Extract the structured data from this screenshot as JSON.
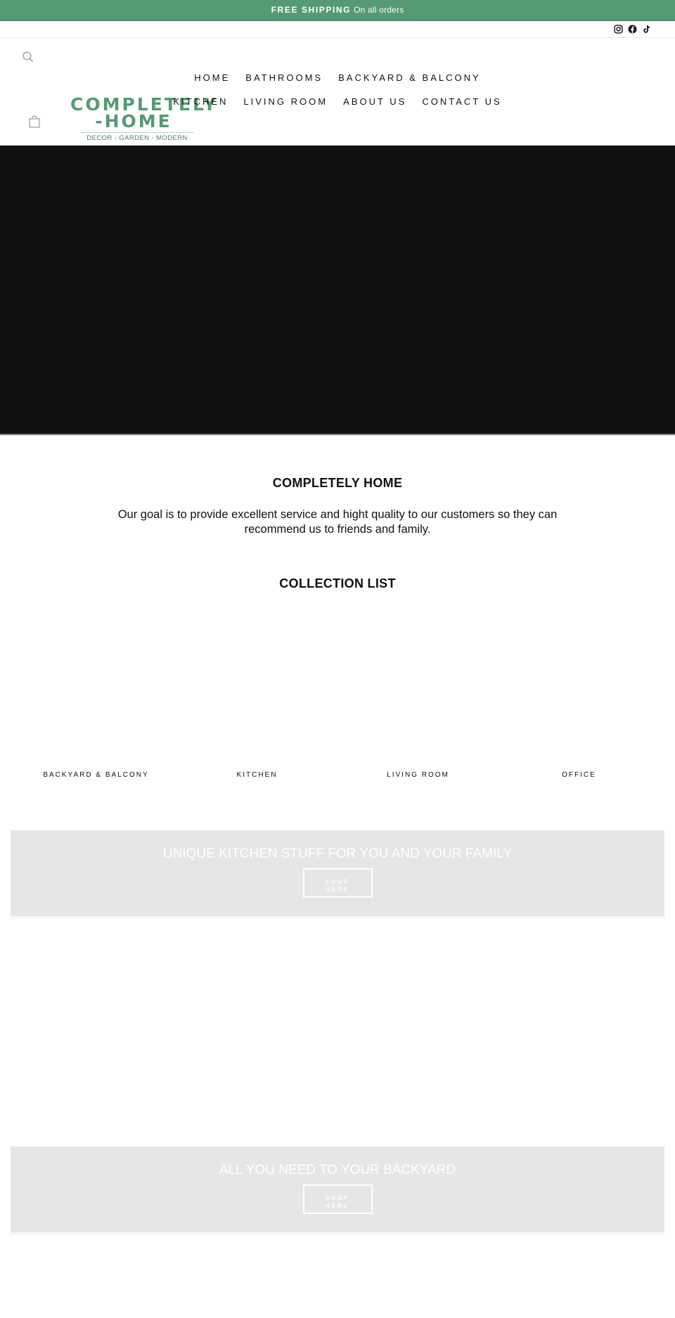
{
  "announcement": {
    "bold": "FREE SHIPPING",
    "text": "On all orders",
    "background": "#569a73"
  },
  "social": [
    {
      "name": "instagram",
      "icon": "instagram-icon"
    },
    {
      "name": "facebook",
      "icon": "facebook-icon"
    },
    {
      "name": "tiktok",
      "icon": "tiktok-icon"
    }
  ],
  "header": {
    "search_icon": "search-icon",
    "cart_icon": "cart-icon",
    "logo": {
      "line1": "COMPLETELY",
      "line2": "-HOME",
      "tagline": "DECOR - GARDEN - MODERN",
      "color": "#569a73"
    },
    "nav_row1": [
      "HOME",
      "BATHROOMS",
      "BACKYARD & BALCONY"
    ],
    "nav_row2": [
      "KITCHEN",
      "LIVING ROOM",
      "ABOUT US",
      "CONTACT US"
    ]
  },
  "hero": {
    "background": "#111111"
  },
  "intro": {
    "title": "COMPLETELY HOME",
    "text": "Our goal is to provide excellent service and hight quality to our customers so they can recommend us to friends and family."
  },
  "collections": {
    "title": "COLLECTION LIST",
    "items": [
      "BACKYARD & BALCONY",
      "KITCHEN",
      "LIVING ROOM",
      "OFFICE"
    ]
  },
  "promos": [
    {
      "title": "UNIQUE KITCHEN STUFF FOR YOU AND YOUR FAMILY",
      "button_line1": "SHOP",
      "button_line2": "HERE"
    },
    {
      "title": "ALL YOU NEED TO YOUR BACKYARD",
      "button_line1": "SHOP",
      "button_line2": "HERE"
    }
  ]
}
